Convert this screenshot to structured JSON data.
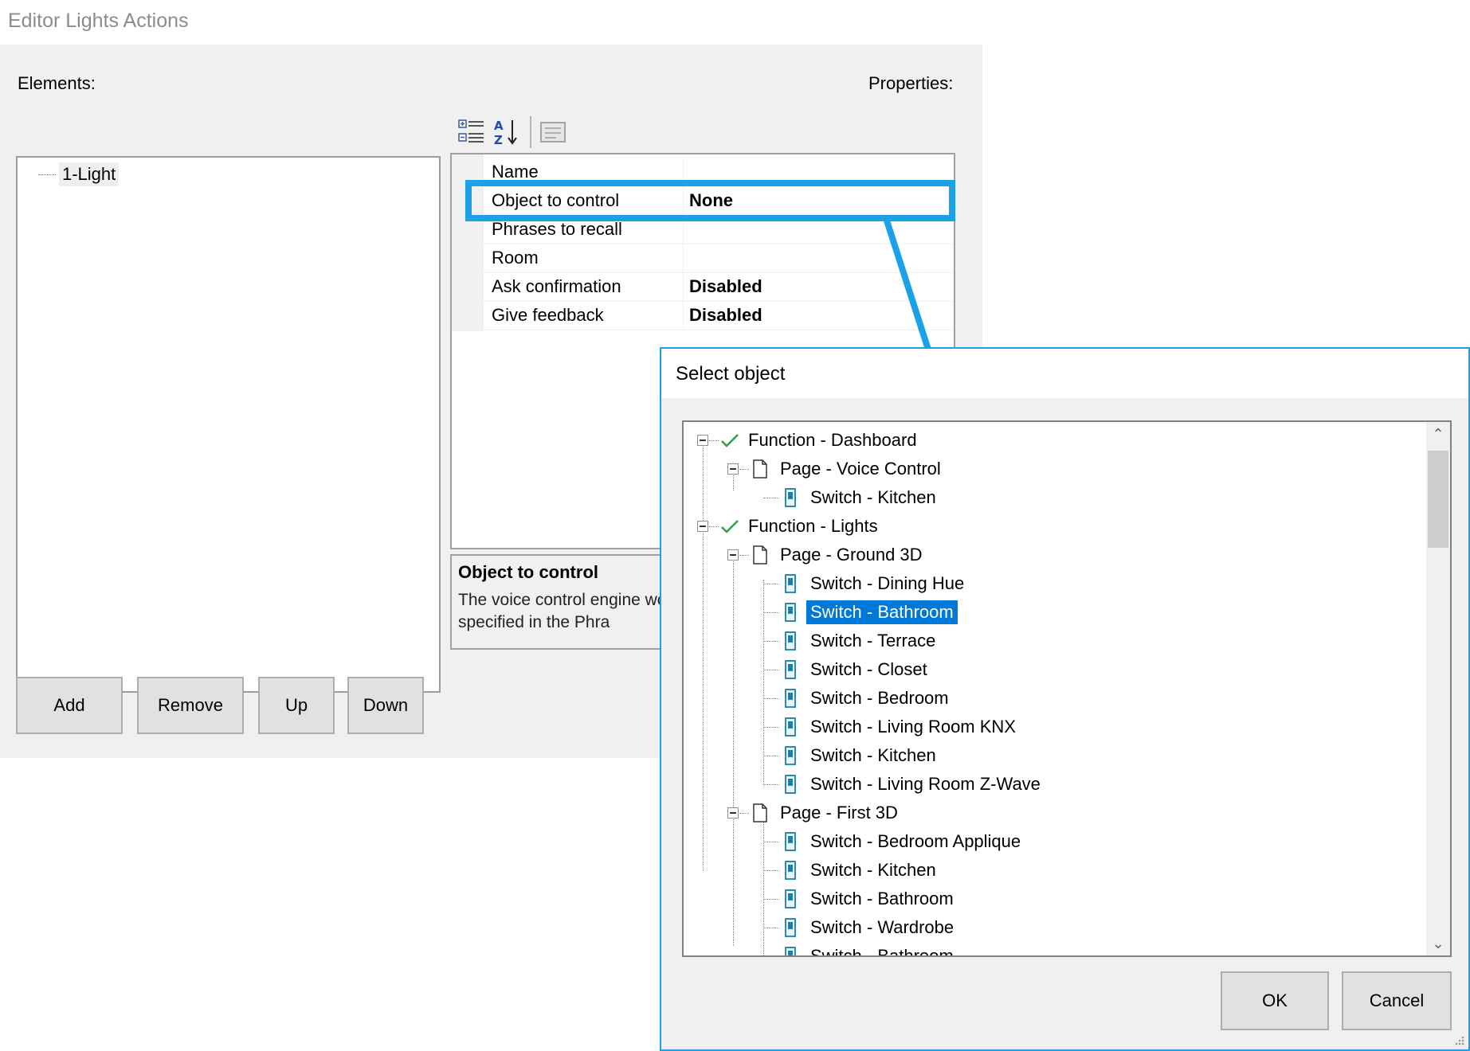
{
  "window": {
    "title": "Editor Lights Actions"
  },
  "editor": {
    "elements_label": "Elements:",
    "properties_label": "Properties:",
    "elements": [
      {
        "label": "1-Light"
      }
    ],
    "buttons": {
      "add": "Add",
      "remove": "Remove",
      "up": "Up",
      "down": "Down"
    },
    "properties": [
      {
        "name": "Name",
        "value": ""
      },
      {
        "name": "Object to control",
        "value": "None"
      },
      {
        "name": "Phrases to recall",
        "value": ""
      },
      {
        "name": "Room",
        "value": ""
      },
      {
        "name": "Ask confirmation",
        "value": "Disabled"
      },
      {
        "name": "Give feedback",
        "value": "Disabled"
      }
    ],
    "description": {
      "title": "Object to control",
      "body": "The voice control engine words specified in the Phra"
    }
  },
  "dialog": {
    "title": "Select object",
    "tree": [
      {
        "label": "Function - Dashboard"
      },
      {
        "label": "Page - Voice Control"
      },
      {
        "label": "Switch - Kitchen"
      },
      {
        "label": "Function - Lights"
      },
      {
        "label": "Page - Ground 3D"
      },
      {
        "label": "Switch - Dining Hue"
      },
      {
        "label": "Switch - Bathroom"
      },
      {
        "label": "Switch - Terrace"
      },
      {
        "label": "Switch - Closet"
      },
      {
        "label": "Switch - Bedroom"
      },
      {
        "label": "Switch - Living Room KNX"
      },
      {
        "label": "Switch - Kitchen"
      },
      {
        "label": "Switch - Living Room Z-Wave"
      },
      {
        "label": "Page - First 3D"
      },
      {
        "label": "Switch - Bedroom Applique"
      },
      {
        "label": "Switch - Kitchen"
      },
      {
        "label": "Switch - Bathroom"
      },
      {
        "label": "Switch - Wardrobe"
      },
      {
        "label": "Switch - Bathroom"
      }
    ],
    "buttons": {
      "ok": "OK",
      "cancel": "Cancel"
    }
  },
  "colors": {
    "accent": "#1ba1e8",
    "selection": "#0078d7",
    "check": "#2e9e4f"
  }
}
